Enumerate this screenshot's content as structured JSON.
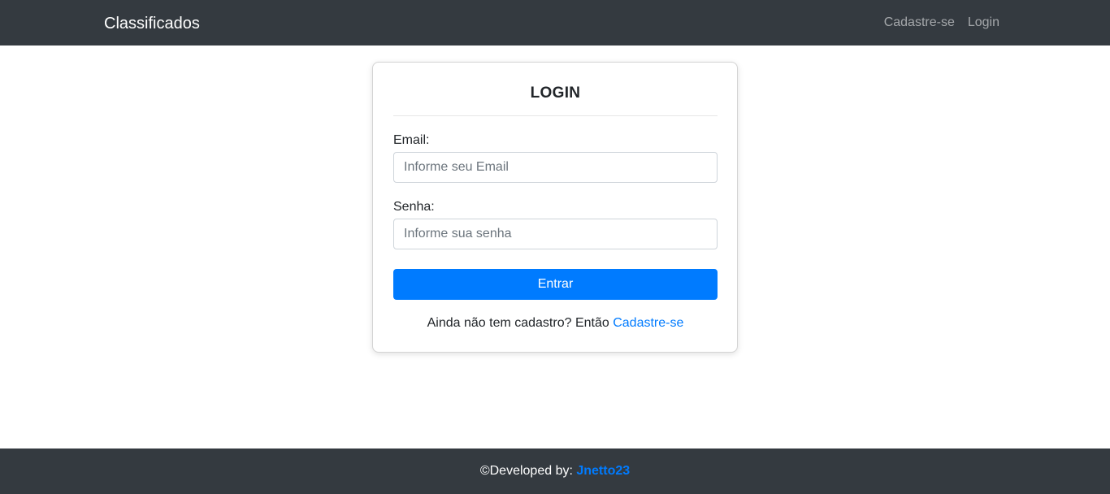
{
  "navbar": {
    "brand": "Classificados",
    "links": [
      {
        "label": "Cadastre-se"
      },
      {
        "label": "Login"
      }
    ]
  },
  "login_card": {
    "title": "LOGIN",
    "email": {
      "label": "Email:",
      "placeholder": "Informe seu Email",
      "value": ""
    },
    "password": {
      "label": "Senha:",
      "placeholder": "Informe sua senha",
      "value": ""
    },
    "submit_label": "Entrar",
    "signup_prompt": "Ainda não tem cadastro? Então",
    "signup_link": "Cadastre-se"
  },
  "footer": {
    "prefix": "©Developed by:",
    "author": "Jnetto23"
  },
  "colors": {
    "navbar_bg": "#343a40",
    "primary": "#007bff",
    "muted_link": "rgba(255,255,255,0.55)"
  }
}
